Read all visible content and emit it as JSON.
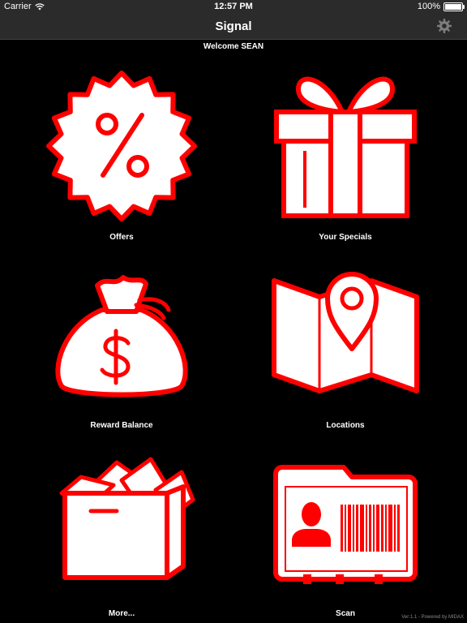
{
  "status_bar": {
    "carrier": "Carrier",
    "time": "12:57 PM",
    "battery": "100%",
    "battery_level": 1.0
  },
  "nav": {
    "title": "Signal",
    "settings_icon": "gear-icon"
  },
  "welcome": "Welcome SEAN",
  "tiles": [
    {
      "label": "Offers",
      "icon": "percent-badge-icon"
    },
    {
      "label": "Your Specials",
      "icon": "gift-icon"
    },
    {
      "label": "Reward Balance",
      "icon": "money-bag-icon"
    },
    {
      "label": "Locations",
      "icon": "map-pin-icon"
    },
    {
      "label": "More...",
      "icon": "open-box-icon"
    },
    {
      "label": "Scan",
      "icon": "id-card-barcode-icon"
    }
  ],
  "footer": {
    "version": "Ver:1.1 - Powered by MIDAX"
  },
  "colors": {
    "accent": "#ff0000",
    "icon_fill": "#ffffff",
    "background": "#000000",
    "bar": "#2b2b2b"
  }
}
